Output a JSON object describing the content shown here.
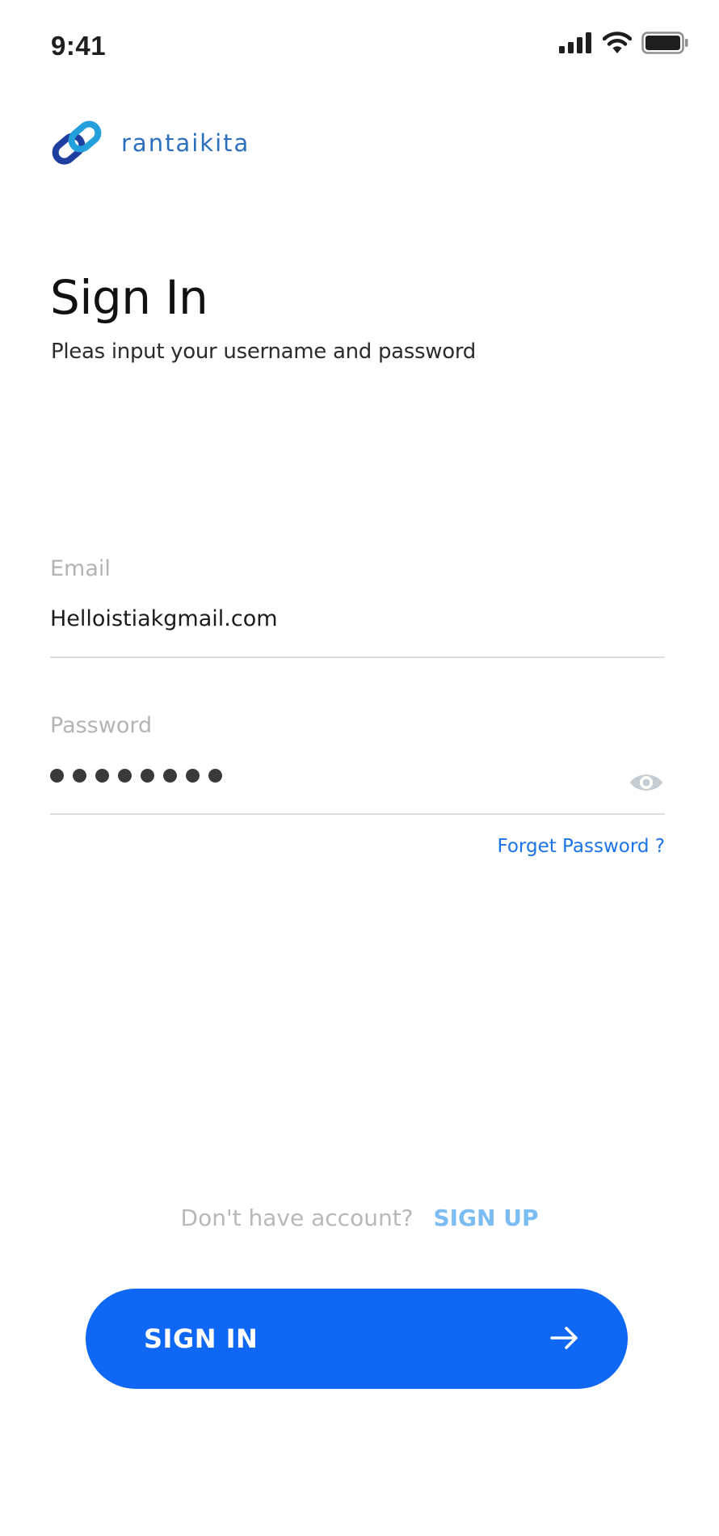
{
  "status_bar": {
    "time": "9:41",
    "icons": [
      "cellular-signal-icon",
      "wifi-icon",
      "battery-icon"
    ]
  },
  "brand": {
    "name": "rantaikita",
    "logo_icon": "chain-link-icon",
    "color": "#2c6fbf"
  },
  "header": {
    "title": "Sign In",
    "subtitle": "Pleas input your username and password"
  },
  "form": {
    "email": {
      "label": "Email",
      "value": "Helloistiakgmail.com"
    },
    "password": {
      "label": "Password",
      "masked_length": 8,
      "toggle_icon": "eye-icon"
    },
    "forget_password": "Forget Password  ?"
  },
  "signup": {
    "prompt": "Don't have account?",
    "link": "SIGN UP"
  },
  "primary_action": {
    "label": "SIGN IN",
    "icon": "arrow-right-icon",
    "color": "#0f67f5"
  }
}
